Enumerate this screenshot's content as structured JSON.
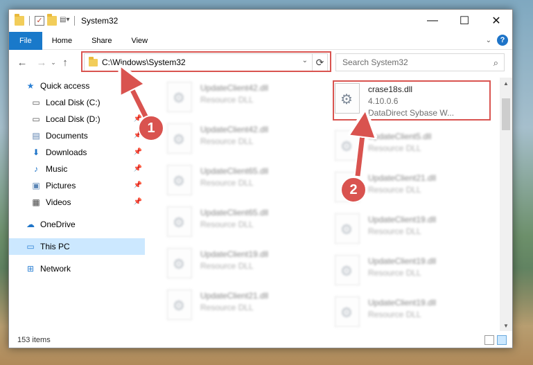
{
  "window": {
    "title": "System32",
    "controls": {
      "minimize": "—",
      "maximize": "☐",
      "close": "✕"
    }
  },
  "ribbon": {
    "tabs": [
      "File",
      "Home",
      "Share",
      "View"
    ],
    "help": "?"
  },
  "address": {
    "path": "C:\\Windows\\System32"
  },
  "search": {
    "placeholder": "Search System32"
  },
  "sidebar": {
    "items": [
      {
        "label": "Quick access",
        "icon": "star-icon"
      },
      {
        "label": "Local Disk (C:)",
        "icon": "drive-icon"
      },
      {
        "label": "Local Disk (D:)",
        "icon": "drive-icon"
      },
      {
        "label": "Documents",
        "icon": "documents-icon"
      },
      {
        "label": "Downloads",
        "icon": "download-icon"
      },
      {
        "label": "Music",
        "icon": "music-icon"
      },
      {
        "label": "Pictures",
        "icon": "pictures-icon"
      },
      {
        "label": "Videos",
        "icon": "videos-icon"
      },
      {
        "label": "OneDrive",
        "icon": "cloud-icon"
      },
      {
        "label": "This PC",
        "icon": "computer-icon"
      },
      {
        "label": "Network",
        "icon": "network-icon"
      }
    ]
  },
  "files": {
    "target": {
      "name": "crase18s.dll",
      "version": "4.10.0.6",
      "description": "DataDirect Sybase W..."
    },
    "left": [
      {
        "name": "UpdateClient42.dll",
        "type": "Resource DLL"
      },
      {
        "name": "UpdateClient42.dll",
        "type": "Resource DLL"
      },
      {
        "name": "UpdateClient65.dll",
        "type": "Resource DLL"
      },
      {
        "name": "UpdateClient65.dll",
        "type": "Resource DLL"
      },
      {
        "name": "UpdateClient19.dll",
        "type": "Resource DLL"
      },
      {
        "name": "UpdateClient21.dll",
        "type": "Resource DLL"
      }
    ],
    "right": [
      {
        "name": "UpdateClient5.dll",
        "type": "Resource DLL"
      },
      {
        "name": "UpdateClient21.dll",
        "type": "Resource DLL"
      },
      {
        "name": "UpdateClient19.dll",
        "type": "Resource DLL"
      },
      {
        "name": "UpdateClient19.dll",
        "type": "Resource DLL"
      },
      {
        "name": "UpdateClient19.dll",
        "type": "Resource DLL"
      }
    ]
  },
  "status": {
    "item_count": "153 items"
  },
  "annotations": {
    "step1": "1",
    "step2": "2",
    "color": "#d9534f"
  }
}
